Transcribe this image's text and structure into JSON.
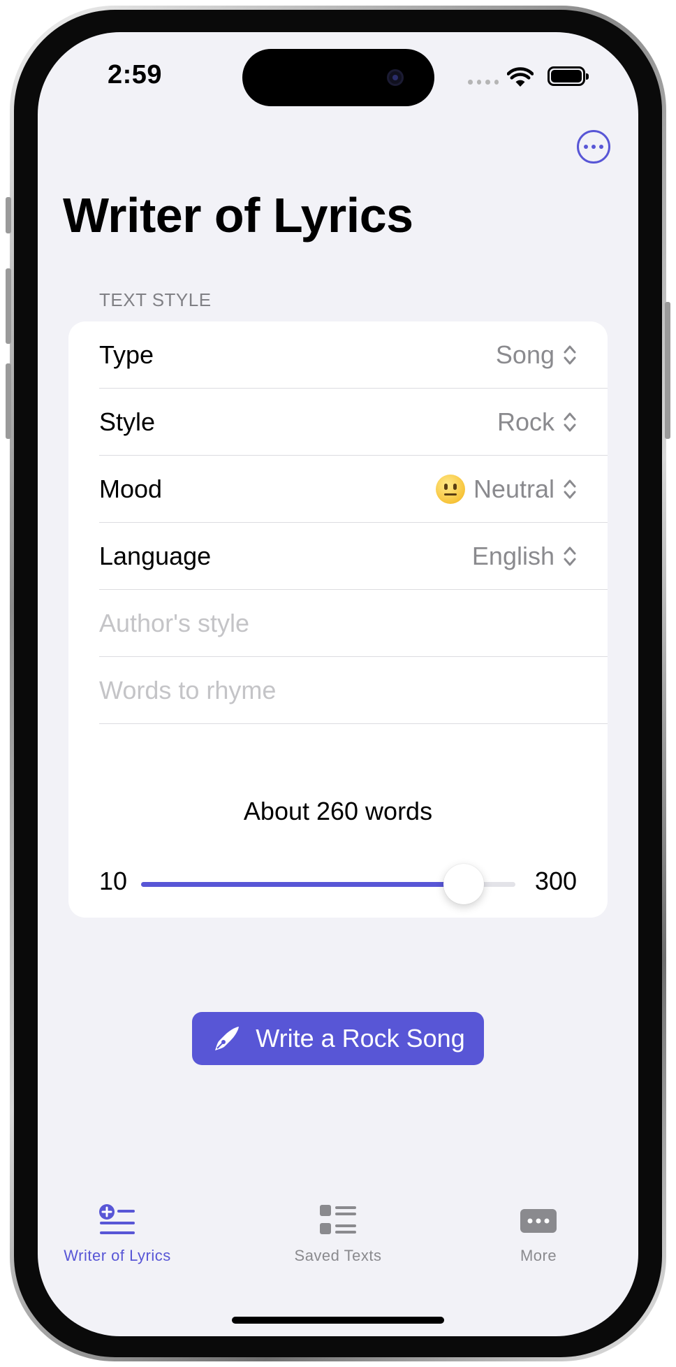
{
  "status_bar": {
    "time": "2:59"
  },
  "header": {
    "title": "Writer of Lyrics",
    "more_icon": "ellipsis-circle-icon"
  },
  "text_style": {
    "section_header": "TEXT STYLE",
    "rows": [
      {
        "label": "Type",
        "value": "Song"
      },
      {
        "label": "Style",
        "value": "Rock"
      },
      {
        "label": "Mood",
        "value": "Neutral",
        "emoji": "neutral-face"
      },
      {
        "label": "Language",
        "value": "English"
      }
    ],
    "author_style": {
      "placeholder": "Author's style",
      "value": ""
    },
    "words_to_rhyme": {
      "placeholder": "Words to rhyme",
      "value": ""
    },
    "word_count": {
      "label": "About 260 words",
      "min": "10",
      "max": "300",
      "value": 260
    }
  },
  "write_button": {
    "label": "Write a Rock Song",
    "icon": "fountain-pen-icon"
  },
  "tab_bar": {
    "tabs": [
      {
        "label": "Writer of Lyrics",
        "icon": "text-badge-plus-icon",
        "active": true
      },
      {
        "label": "Saved Texts",
        "icon": "list-bullet-rectangle-icon",
        "active": false
      },
      {
        "label": "More",
        "icon": "ellipsis-rectangle-icon",
        "active": false
      }
    ]
  },
  "colors": {
    "accent": "#5856d6",
    "background": "#f2f2f7",
    "card": "#ffffff",
    "secondary_text": "#8a8a8e",
    "placeholder": "#c4c4c7"
  }
}
